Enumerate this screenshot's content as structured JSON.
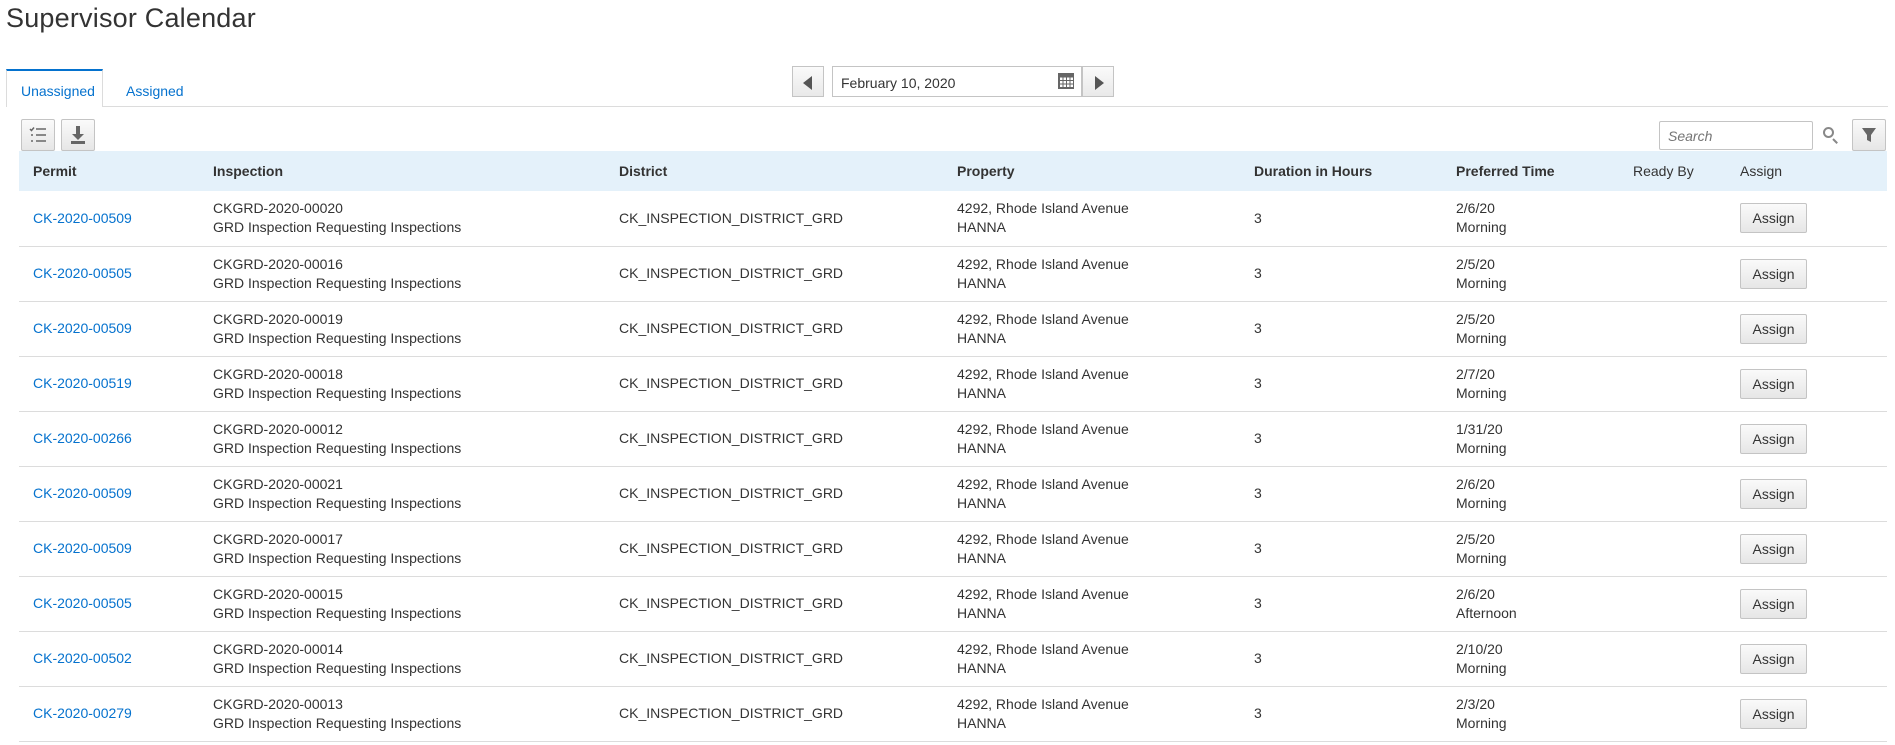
{
  "page": {
    "title": "Supervisor Calendar"
  },
  "tabs": [
    {
      "label": "Unassigned",
      "active": true
    },
    {
      "label": "Assigned",
      "active": false
    }
  ],
  "date_nav": {
    "date": "February 10, 2020",
    "prev_icon": "triangle-left",
    "next_icon": "triangle-right",
    "calendar_icon": "calendar"
  },
  "toolbar": {
    "columns_icon": "column-list",
    "export_icon": "download",
    "filter_icon": "filter"
  },
  "search": {
    "placeholder": "Search",
    "icon": "magnifier"
  },
  "table": {
    "headers": [
      "Permit",
      "Inspection",
      "District",
      "Property",
      "Duration in Hours",
      "Preferred Time",
      "Ready By",
      "Assign"
    ],
    "rows": [
      {
        "permit": "CK-2020-00509",
        "inspection_id": "CKGRD-2020-00020",
        "inspection_desc": "GRD Inspection Requesting Inspections",
        "district": "CK_INSPECTION_DISTRICT_GRD",
        "property_address": "4292, Rhode Island Avenue",
        "property_city": "HANNA",
        "duration": "3",
        "pref_date": "2/6/20",
        "pref_time": "Morning",
        "ready_by": "",
        "assign_label": "Assign"
      },
      {
        "permit": "CK-2020-00505",
        "inspection_id": "CKGRD-2020-00016",
        "inspection_desc": "GRD Inspection Requesting Inspections",
        "district": "CK_INSPECTION_DISTRICT_GRD",
        "property_address": "4292, Rhode Island Avenue",
        "property_city": "HANNA",
        "duration": "3",
        "pref_date": "2/5/20",
        "pref_time": "Morning",
        "ready_by": "",
        "assign_label": "Assign"
      },
      {
        "permit": "CK-2020-00509",
        "inspection_id": "CKGRD-2020-00019",
        "inspection_desc": "GRD Inspection Requesting Inspections",
        "district": "CK_INSPECTION_DISTRICT_GRD",
        "property_address": "4292, Rhode Island Avenue",
        "property_city": "HANNA",
        "duration": "3",
        "pref_date": "2/5/20",
        "pref_time": "Morning",
        "ready_by": "",
        "assign_label": "Assign"
      },
      {
        "permit": "CK-2020-00519",
        "inspection_id": "CKGRD-2020-00018",
        "inspection_desc": "GRD Inspection Requesting Inspections",
        "district": "CK_INSPECTION_DISTRICT_GRD",
        "property_address": "4292, Rhode Island Avenue",
        "property_city": "HANNA",
        "duration": "3",
        "pref_date": "2/7/20",
        "pref_time": "Morning",
        "ready_by": "",
        "assign_label": "Assign"
      },
      {
        "permit": "CK-2020-00266",
        "inspection_id": "CKGRD-2020-00012",
        "inspection_desc": "GRD Inspection Requesting Inspections",
        "district": "CK_INSPECTION_DISTRICT_GRD",
        "property_address": "4292, Rhode Island Avenue",
        "property_city": "HANNA",
        "duration": "3",
        "pref_date": "1/31/20",
        "pref_time": "Morning",
        "ready_by": "",
        "assign_label": "Assign"
      },
      {
        "permit": "CK-2020-00509",
        "inspection_id": "CKGRD-2020-00021",
        "inspection_desc": "GRD Inspection Requesting Inspections",
        "district": "CK_INSPECTION_DISTRICT_GRD",
        "property_address": "4292, Rhode Island Avenue",
        "property_city": "HANNA",
        "duration": "3",
        "pref_date": "2/6/20",
        "pref_time": "Morning",
        "ready_by": "",
        "assign_label": "Assign"
      },
      {
        "permit": "CK-2020-00509",
        "inspection_id": "CKGRD-2020-00017",
        "inspection_desc": "GRD Inspection Requesting Inspections",
        "district": "CK_INSPECTION_DISTRICT_GRD",
        "property_address": "4292, Rhode Island Avenue",
        "property_city": "HANNA",
        "duration": "3",
        "pref_date": "2/5/20",
        "pref_time": "Morning",
        "ready_by": "",
        "assign_label": "Assign"
      },
      {
        "permit": "CK-2020-00505",
        "inspection_id": "CKGRD-2020-00015",
        "inspection_desc": "GRD Inspection Requesting Inspections",
        "district": "CK_INSPECTION_DISTRICT_GRD",
        "property_address": "4292, Rhode Island Avenue",
        "property_city": "HANNA",
        "duration": "3",
        "pref_date": "2/6/20",
        "pref_time": "Afternoon",
        "ready_by": "",
        "assign_label": "Assign"
      },
      {
        "permit": "CK-2020-00502",
        "inspection_id": "CKGRD-2020-00014",
        "inspection_desc": "GRD Inspection Requesting Inspections",
        "district": "CK_INSPECTION_DISTRICT_GRD",
        "property_address": "4292, Rhode Island Avenue",
        "property_city": "HANNA",
        "duration": "3",
        "pref_date": "2/10/20",
        "pref_time": "Morning",
        "ready_by": "",
        "assign_label": "Assign"
      },
      {
        "permit": "CK-2020-00279",
        "inspection_id": "CKGRD-2020-00013",
        "inspection_desc": "GRD Inspection Requesting Inspections",
        "district": "CK_INSPECTION_DISTRICT_GRD",
        "property_address": "4292, Rhode Island Avenue",
        "property_city": "HANNA",
        "duration": "3",
        "pref_date": "2/3/20",
        "pref_time": "Morning",
        "ready_by": "",
        "assign_label": "Assign"
      }
    ]
  },
  "colors": {
    "link": "#0572ce",
    "header_bg": "#e4f1fa",
    "border": "#dcdcdc",
    "text": "#333333"
  }
}
